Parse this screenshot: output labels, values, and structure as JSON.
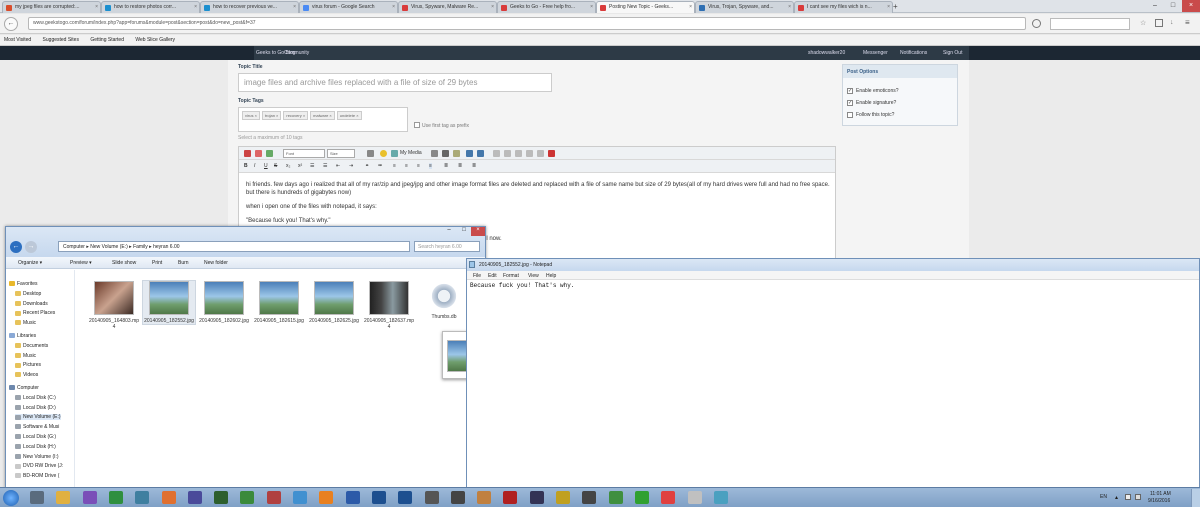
{
  "browser": {
    "tabs": [
      {
        "title": "my jpeg files are corrupted:...",
        "color": "#d94d2c"
      },
      {
        "title": "how to restore photos corr...",
        "color": "#1b8fcf"
      },
      {
        "title": "how to recover previous ve...",
        "color": "#1b8fcf"
      },
      {
        "title": "virus forum - Google Search",
        "color": "#4a8af4"
      },
      {
        "title": "Virus, Spyware, Malware Re...",
        "color": "#d93b3b"
      },
      {
        "title": "Geeks to Go - Free help fro...",
        "color": "#d93b3b"
      },
      {
        "title": "Posting New Topic - Geeks...",
        "color": "#d93b3b",
        "active": true
      },
      {
        "title": "Virus, Trojan, Spyware, and...",
        "color": "#2f6fb3"
      },
      {
        "title": "I cant see my files wich is n...",
        "color": "#d93b3b"
      }
    ],
    "url": "www.geekstogo.com/forum/index.php?app=forums&module=post&section=post&do=new_post&f=37",
    "bookmarks": [
      "Most Visited",
      "Suggested Sites",
      "Getting Started",
      "Web Slice Gallery"
    ]
  },
  "site": {
    "nav": [
      "Geeks to Go Blog",
      "Community"
    ],
    "user": "shadowwalker20",
    "user_links": [
      "Messenger",
      "Notifications",
      "Sign Out"
    ]
  },
  "form": {
    "topic_title_label": "Topic Title",
    "topic_title_value": "image files and archive files replaced with a file of size of 29 bytes",
    "topic_tags_label": "Topic Tags",
    "tags": [
      "virus",
      "trojan",
      "recovery",
      "malware",
      "undelete"
    ],
    "use_first_tag": "Use first tag as prefix",
    "tags_hint": "Select a maximum of 10 tags",
    "toolbar": {
      "font": "Font",
      "size": "Size",
      "my_media": "My Media"
    },
    "post_paragraphs": [
      "hi friends. few days ago i realized that  all of my rar/zip and jpeg/jpg and other image format files are deleted and replaced with a file of same name but size of 29 bytes(all of my hard drives were full and had no free space. but there is hundreds of gigabytes now)",
      "when i open one of the files with notepad, it says:",
      "\"Because fuck you! That's why.\""
    ],
    "post_tail": "ntil now."
  },
  "post_options": {
    "title": "Post Options",
    "items": [
      {
        "label": "Enable emoticons?",
        "checked": true
      },
      {
        "label": "Enable signature?",
        "checked": true
      },
      {
        "label": "Follow this topic?",
        "checked": false
      }
    ]
  },
  "explorer": {
    "breadcrumb": [
      "Computer",
      "New Volume (E:)",
      "Family",
      "heyran 6.00"
    ],
    "search_placeholder": "Search heyran 6.00",
    "commands": [
      "Organize ▾",
      "Preview ▾",
      "Slide show",
      "Print",
      "Burn",
      "New folder"
    ],
    "nav": [
      {
        "label": "Favorites",
        "icon": "star",
        "head": true
      },
      {
        "label": "Desktop",
        "icon": "folder"
      },
      {
        "label": "Downloads",
        "icon": "folder"
      },
      {
        "label": "Recent Places",
        "icon": "folder"
      },
      {
        "label": "Music",
        "icon": "folder"
      },
      {
        "label": "Libraries",
        "icon": "library",
        "head": true
      },
      {
        "label": "Documents",
        "icon": "folder"
      },
      {
        "label": "Music",
        "icon": "folder"
      },
      {
        "label": "Pictures",
        "icon": "folder"
      },
      {
        "label": "Videos",
        "icon": "folder"
      },
      {
        "label": "Computer",
        "icon": "computer",
        "head": true
      },
      {
        "label": "Local Disk (C:)",
        "icon": "drive"
      },
      {
        "label": "Local Disk (D:)",
        "icon": "drive"
      },
      {
        "label": "New Volume (E:)",
        "icon": "drive",
        "selected": true
      },
      {
        "label": "Software & Musi",
        "icon": "drive"
      },
      {
        "label": "Local Disk (G:)",
        "icon": "drive"
      },
      {
        "label": "Local Disk (H:)",
        "icon": "drive"
      },
      {
        "label": "New Volume (I:)",
        "icon": "drive"
      },
      {
        "label": "DVD RW Drive (J:",
        "icon": "dvd"
      },
      {
        "label": "BD-ROM Drive (",
        "icon": "dvd"
      }
    ],
    "files": [
      {
        "name": "20140905_164803.mp4",
        "thumb": "red"
      },
      {
        "name": "20140905_182552.jpg",
        "thumb": "sky",
        "selected": true
      },
      {
        "name": "20140905_182602.jpg",
        "thumb": "sky"
      },
      {
        "name": "20140905_182615.jpg",
        "thumb": "sky"
      },
      {
        "name": "20140905_182625.jpg",
        "thumb": "sky"
      },
      {
        "name": "20140905_182637.mp4",
        "thumb": "dark"
      },
      {
        "name": "Thumbs.db",
        "thumb": "gear"
      }
    ]
  },
  "notepad": {
    "title": "20140905_182552.jpg - Notepad",
    "menu": [
      "File",
      "Edit",
      "Format",
      "View",
      "Help"
    ],
    "content": "Because fuck you! That's why."
  },
  "taskbar": {
    "apps": [
      "#5a6b7d",
      "#e0b040",
      "#7a4fb8",
      "#2f8f3f",
      "#3f7fa0",
      "#e07030",
      "#4a4a9a",
      "#2d5f2d",
      "#3b8a3b",
      "#b04040",
      "#4090d0",
      "#e88020",
      "#2c5aa8",
      "#1d4f8f",
      "#1d4f8f",
      "#555555",
      "#444444",
      "#c08040",
      "#b02020",
      "#333355",
      "#c0a020",
      "#444444",
      "#3f8f3f",
      "#30a030",
      "#e04040",
      "#c0c0c0",
      "#4aa0c0"
    ],
    "lang": "EN",
    "time": "11:01 AM",
    "date": "9/16/2016"
  }
}
